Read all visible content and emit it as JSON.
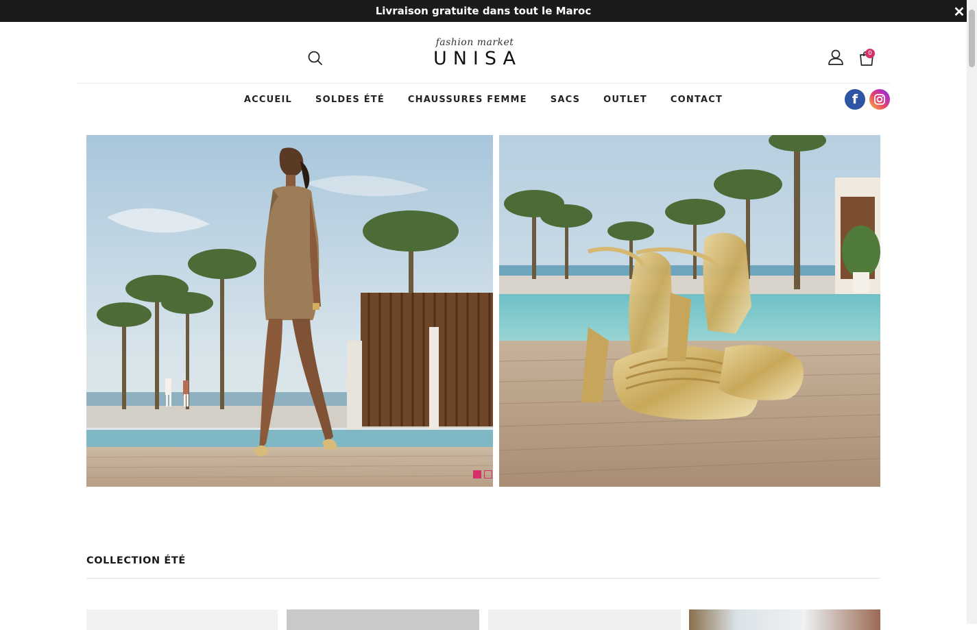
{
  "announcement": {
    "text": "Livraison gratuite dans tout le Maroc",
    "close_glyph": "✕"
  },
  "header": {
    "logo": {
      "tagline": "fashion market",
      "name": "UNISA"
    },
    "search_icon": "search-icon",
    "account_icon": "user-icon",
    "cart_icon": "shopping-bag-icon",
    "cart_count": "0"
  },
  "nav": {
    "items": [
      {
        "label": "ACCUEIL"
      },
      {
        "label": "SOLDES ÉTÉ"
      },
      {
        "label": "CHAUSSURES FEMME"
      },
      {
        "label": "SACS"
      },
      {
        "label": "OUTLET"
      },
      {
        "label": "CONTACT"
      }
    ]
  },
  "social": {
    "facebook_glyph": "f",
    "facebook_icon": "facebook-icon",
    "instagram_icon": "instagram-icon"
  },
  "hero": {
    "slide_count": 2,
    "active_slide": 1
  },
  "collection": {
    "title": "COLLECTION ÉTÉ"
  },
  "colors": {
    "accent": "#d6306a",
    "topbar": "#1b1b1b",
    "facebook": "#2d55a4"
  }
}
